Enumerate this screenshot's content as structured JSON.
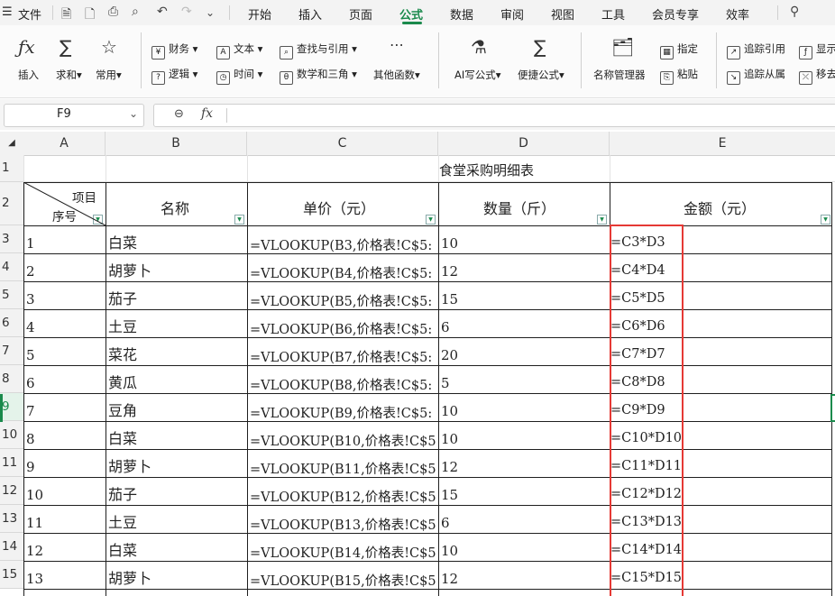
{
  "menubar": {
    "file_menu": "文件",
    "tabs": [
      "开始",
      "插入",
      "页面",
      "公式",
      "数据",
      "审阅",
      "视图",
      "工具",
      "会员专享",
      "效率"
    ],
    "active_tab": "公式"
  },
  "ribbon": {
    "insert_fn": "插入",
    "sum": "求和",
    "common": "常用",
    "finance": "财务",
    "text": "文本",
    "lookup": "查找与引用",
    "logic": "逻辑",
    "time": "时间",
    "math": "数学和三角",
    "other": "其他函数",
    "ai_formula": "AI写公式",
    "quick_formula": "便捷公式",
    "name_manager": "名称管理器",
    "specify": "指定",
    "paste": "粘贴",
    "trace_precedents": "追踪引用",
    "trace_dependents": "追踪从属",
    "show": "显示",
    "remove": "移去"
  },
  "formula_bar": {
    "name_box": "F9",
    "fx": "fx",
    "formula": ""
  },
  "sheet": {
    "columns": [
      "A",
      "B",
      "C",
      "D",
      "E"
    ],
    "row_numbers": [
      "1",
      "2",
      "3",
      "4",
      "5",
      "6",
      "7",
      "8",
      "9",
      "10",
      "11",
      "12",
      "13",
      "14",
      "15"
    ],
    "title": "食堂采购明细表",
    "header_diag_top": "项目",
    "header_diag_bottom": "序号",
    "header_b": "名称",
    "header_c": "单价（元）",
    "header_d": "数量（斤）",
    "header_e": "金额（元）",
    "rows": [
      {
        "a": "1",
        "b": "白菜",
        "c": "=VLOOKUP(B3,价格表!C$5:",
        "d": "10",
        "e": "=C3*D3"
      },
      {
        "a": "2",
        "b": "胡萝卜",
        "c": "=VLOOKUP(B4,价格表!C$5:",
        "d": "12",
        "e": "=C4*D4"
      },
      {
        "a": "3",
        "b": "茄子",
        "c": "=VLOOKUP(B5,价格表!C$5:",
        "d": "15",
        "e": "=C5*D5"
      },
      {
        "a": "4",
        "b": "土豆",
        "c": "=VLOOKUP(B6,价格表!C$5:",
        "d": "6",
        "e": "=C6*D6"
      },
      {
        "a": "5",
        "b": "菜花",
        "c": "=VLOOKUP(B7,价格表!C$5:",
        "d": "20",
        "e": "=C7*D7"
      },
      {
        "a": "6",
        "b": "黄瓜",
        "c": "=VLOOKUP(B8,价格表!C$5:",
        "d": "5",
        "e": "=C8*D8"
      },
      {
        "a": "7",
        "b": "豆角",
        "c": "=VLOOKUP(B9,价格表!C$5:",
        "d": "10",
        "e": "=C9*D9"
      },
      {
        "a": "8",
        "b": "白菜",
        "c": "=VLOOKUP(B10,价格表!C$5",
        "d": "10",
        "e": "=C10*D10"
      },
      {
        "a": "9",
        "b": "胡萝卜",
        "c": "=VLOOKUP(B11,价格表!C$5",
        "d": "12",
        "e": "=C11*D11"
      },
      {
        "a": "10",
        "b": "茄子",
        "c": "=VLOOKUP(B12,价格表!C$5",
        "d": "15",
        "e": "=C12*D12"
      },
      {
        "a": "11",
        "b": "土豆",
        "c": "=VLOOKUP(B13,价格表!C$5",
        "d": "6",
        "e": "=C13*D13"
      },
      {
        "a": "12",
        "b": "白菜",
        "c": "=VLOOKUP(B14,价格表!C$5",
        "d": "10",
        "e": "=C14*D14"
      },
      {
        "a": "13",
        "b": "胡萝卜",
        "c": "=VLOOKUP(B15,价格表!C$5",
        "d": "12",
        "e": "=C15*D15"
      }
    ]
  },
  "colors": {
    "accent": "#1a8a4c",
    "highlight_border": "#e53935"
  }
}
